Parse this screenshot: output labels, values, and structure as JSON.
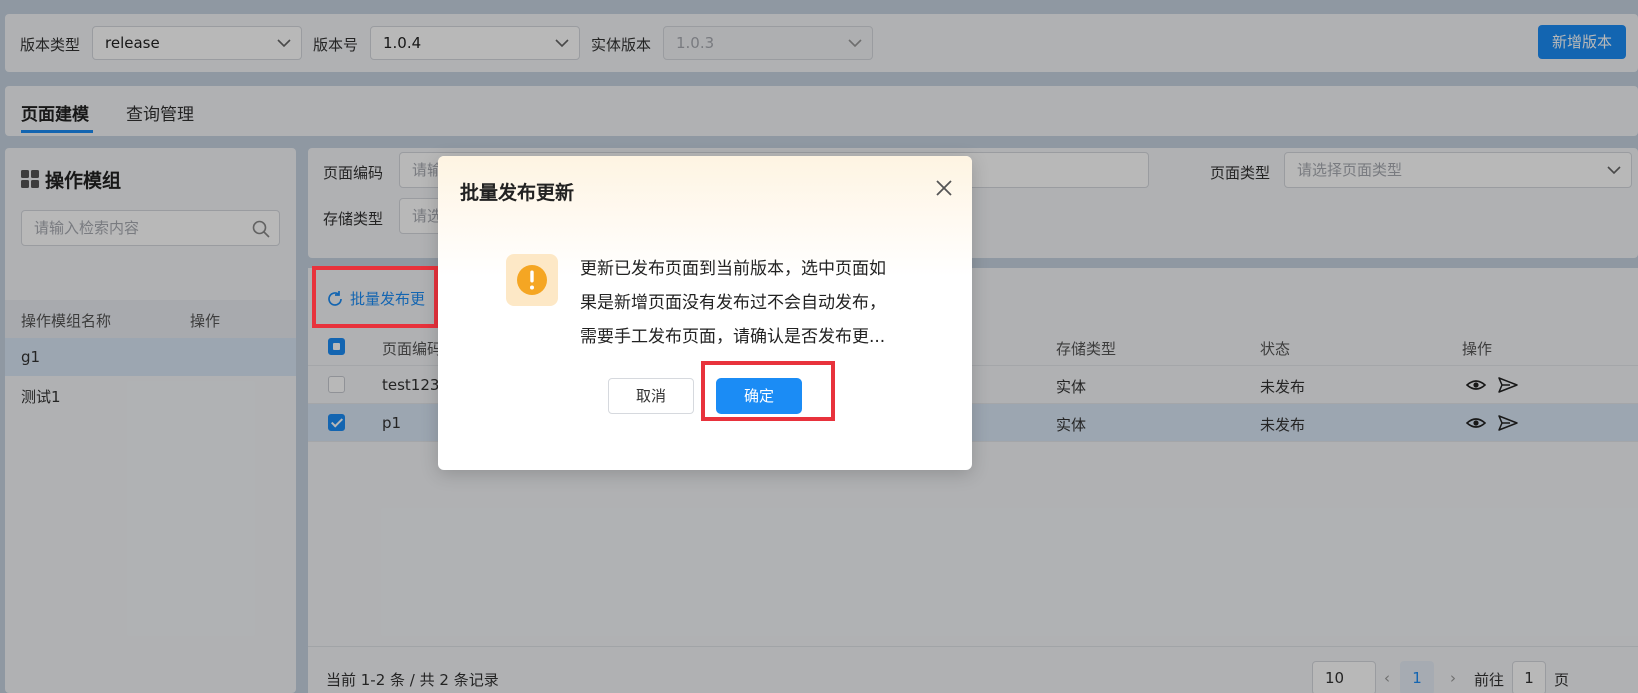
{
  "toolbar": {
    "version_type_label": "版本类型",
    "version_type_value": "release",
    "version_no_label": "版本号",
    "version_no_value": "1.0.4",
    "entity_version_label": "实体版本",
    "entity_version_value": "1.0.3",
    "add_version_label": "新增版本"
  },
  "tabs": [
    {
      "label": "页面建模",
      "active": true
    },
    {
      "label": "查询管理",
      "active": false
    }
  ],
  "sidebar": {
    "title": "操作模组",
    "search_placeholder": "请输入检索内容",
    "col_name": "操作模组名称",
    "col_action": "操作",
    "items": [
      {
        "label": "g1",
        "selected": true
      },
      {
        "label": "测试1",
        "selected": false
      }
    ]
  },
  "filters": {
    "page_code_label": "页面编码",
    "page_code_placeholder": "请输",
    "page_type_label": "页面类型",
    "page_type_placeholder": "请选择页面类型",
    "storage_type_label": "存储类型",
    "storage_type_placeholder": "请选"
  },
  "table": {
    "batch_label": "批量发布更",
    "columns": {
      "code": "页面编码",
      "storage": "存储类型",
      "status": "状态",
      "action": "操作"
    },
    "rows": [
      {
        "code": "test123",
        "storage": "实体",
        "status": "未发布",
        "checked": false
      },
      {
        "code": "p1",
        "storage": "实体",
        "status": "未发布",
        "checked": true
      }
    ],
    "footer_count": "当前 1-2 条 / 共 2 条记录",
    "page_size": "10",
    "current_page": "1",
    "goto_label": "前往",
    "goto_value": "1",
    "page_suffix": "页"
  },
  "dialog": {
    "title": "批量发布更新",
    "message_lines": [
      "更新已发布页面到当前版本，选中页面如",
      "果是新增页面没有发布过不会自动发布，",
      "需要手工发布页面，请确认是否发布更..."
    ],
    "cancel_label": "取消",
    "ok_label": "确定"
  },
  "colors": {
    "primary": "#1b8cf5",
    "highlight": "#e8323c",
    "warning": "#f5a623"
  }
}
